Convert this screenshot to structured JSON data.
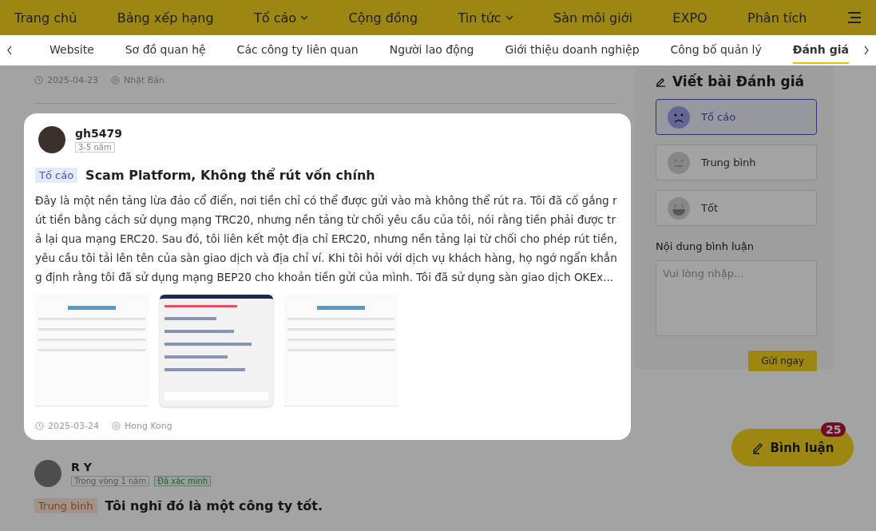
{
  "nav": {
    "items": [
      {
        "label": "Trang chủ",
        "dropdown": false
      },
      {
        "label": "Bảng xếp hạng",
        "dropdown": false
      },
      {
        "label": "Tố cáo",
        "dropdown": true
      },
      {
        "label": "Cộng đồng",
        "dropdown": false
      },
      {
        "label": "Tin tức",
        "dropdown": true
      },
      {
        "label": "Sàn môi giới",
        "dropdown": false
      },
      {
        "label": "EXPO",
        "dropdown": false
      },
      {
        "label": "Phân tích",
        "dropdown": false
      }
    ]
  },
  "subnav": {
    "tabs": [
      {
        "label": "Website",
        "selected": false
      },
      {
        "label": "Sơ đồ quan hệ",
        "selected": false
      },
      {
        "label": "Các công ty liên quan",
        "selected": false
      },
      {
        "label": "Người lao động",
        "selected": false
      },
      {
        "label": "Giới thiệu doanh nghiệp",
        "selected": false
      },
      {
        "label": "Công bố quản lý",
        "selected": false
      },
      {
        "label": "Đánh giá",
        "selected": true
      }
    ]
  },
  "previous_review": {
    "date": "2025-04-23",
    "location": "Nhật Bản"
  },
  "featured_review": {
    "user": "gh5479",
    "badges": [
      {
        "label": "3-5 năm",
        "kind": "tenure"
      }
    ],
    "rating": {
      "label": "Tố cáo",
      "kind": "bad"
    },
    "title": "Scam Platform, Không thể rút vốn chính",
    "body": "Đây là một nền tảng lừa đảo cổ điển, nơi tiền chỉ có thể được gửi vào mà không thể rút ra. Tôi đã cố gắng rút tiền bằng cách sử dụng mạng TRC20, nhưng nền tảng từ chối yêu cầu của tôi, nói rằng tiền phải được trả lại qua mạng ERC20. Sau đó, tôi liên kết một địa chỉ ERC20, nhưng nền tảng lại từ chối cho phép rút tiền, yêu cầu tôi tải lên tên của sàn giao dịch và địa chỉ ví. Khi tôi hỏi với dịch vụ khách hàng, họ ngớ ngẩn khẳng định rằng tôi đã sử dụng mạng BEP20 cho khoản tiền gửi của mình. Tôi đã sử dụng sàn giao dịch OKEx...",
    "images": [
      {
        "kind": "table"
      },
      {
        "kind": "chat"
      },
      {
        "kind": "table"
      }
    ],
    "date": "2025-03-24",
    "location": "Hong Kong"
  },
  "next_review": {
    "user": "R Y",
    "badges": [
      {
        "label": "Trong vòng 1 năm",
        "kind": "tenure"
      },
      {
        "label": "Đã xác minh",
        "kind": "verified"
      }
    ],
    "rating": {
      "label": "Trung bình",
      "kind": "neutral"
    },
    "title": "Tôi nghĩ đó là một công ty tốt."
  },
  "sidebar": {
    "heading": "Viết bài Đánh giá",
    "options": [
      {
        "label": "Tố cáo",
        "kind": "bad",
        "selected": true
      },
      {
        "label": "Trung bình",
        "kind": "neutral",
        "selected": false
      },
      {
        "label": "Tốt",
        "kind": "good",
        "selected": false
      }
    ],
    "comment_label": "Nội dung bình luận",
    "placeholder": "Vui lòng nhập...",
    "submit": "Gửi ngay"
  },
  "comment_button": {
    "label": "Bình luận",
    "count": "25"
  }
}
